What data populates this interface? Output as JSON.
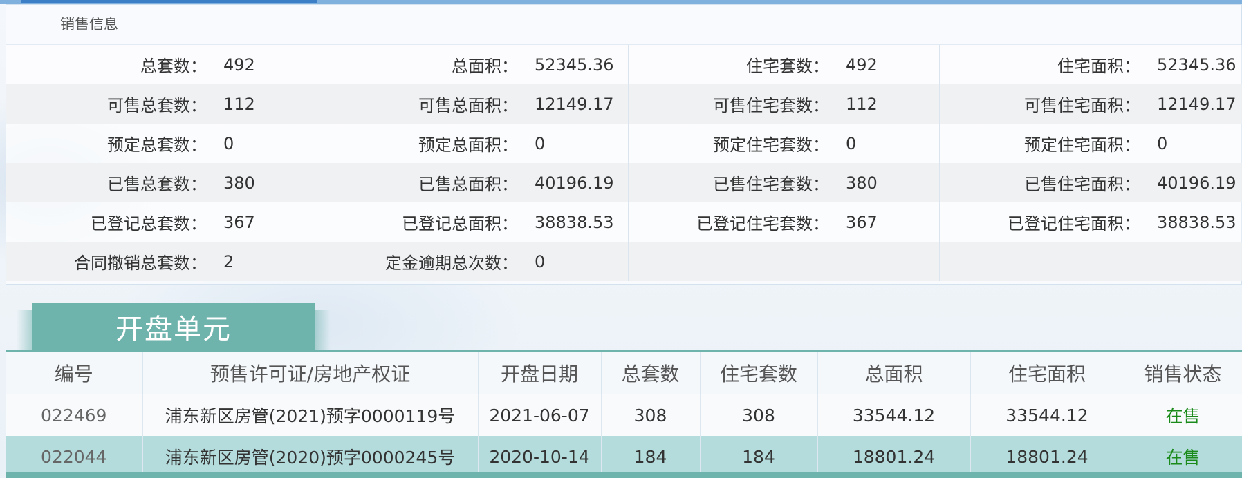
{
  "sales_info": {
    "title": "销售信息",
    "rows": [
      [
        {
          "label": "总套数：",
          "value": "492"
        },
        {
          "label": "总面积：",
          "value": "52345.36"
        },
        {
          "label": "住宅套数：",
          "value": "492"
        },
        {
          "label": "住宅面积：",
          "value": "52345.36"
        }
      ],
      [
        {
          "label": "可售总套数：",
          "value": "112"
        },
        {
          "label": "可售总面积：",
          "value": "12149.17"
        },
        {
          "label": "可售住宅套数：",
          "value": "112"
        },
        {
          "label": "可售住宅面积：",
          "value": "12149.17"
        }
      ],
      [
        {
          "label": "预定总套数：",
          "value": "0"
        },
        {
          "label": "预定总面积：",
          "value": "0"
        },
        {
          "label": "预定住宅套数：",
          "value": "0"
        },
        {
          "label": "预定住宅面积：",
          "value": "0"
        }
      ],
      [
        {
          "label": "已售总套数：",
          "value": "380"
        },
        {
          "label": "已售总面积：",
          "value": "40196.19"
        },
        {
          "label": "已售住宅套数：",
          "value": "380"
        },
        {
          "label": "已售住宅面积：",
          "value": "40196.19"
        }
      ],
      [
        {
          "label": "已登记总套数：",
          "value": "367"
        },
        {
          "label": "已登记总面积：",
          "value": "38838.53"
        },
        {
          "label": "已登记住宅套数：",
          "value": "367"
        },
        {
          "label": "已登记住宅面积：",
          "value": "38838.53"
        }
      ],
      [
        {
          "label": "合同撤销总套数：",
          "value": "2"
        },
        {
          "label": "定金逾期总次数：",
          "value": "0"
        },
        {
          "label": "",
          "value": ""
        },
        {
          "label": "",
          "value": ""
        }
      ]
    ]
  },
  "units": {
    "tab_label": "开盘单元",
    "columns": [
      "编号",
      "预售许可证/房地产权证",
      "开盘日期",
      "总套数",
      "住宅套数",
      "总面积",
      "住宅面积",
      "销售状态"
    ],
    "rows": [
      [
        "022469",
        "浦东新区房管(2021)预字0000119号",
        "2021-06-07",
        "308",
        "308",
        "33544.12",
        "33544.12",
        "在售"
      ],
      [
        "022044",
        "浦东新区房管(2020)预字0000245号",
        "2020-10-14",
        "184",
        "184",
        "18801.24",
        "18801.24",
        "在售"
      ]
    ]
  },
  "colors": {
    "teal": "#6fb3ad",
    "status_green": "#1a8a1a",
    "top_blue": "#3d7fc7"
  }
}
